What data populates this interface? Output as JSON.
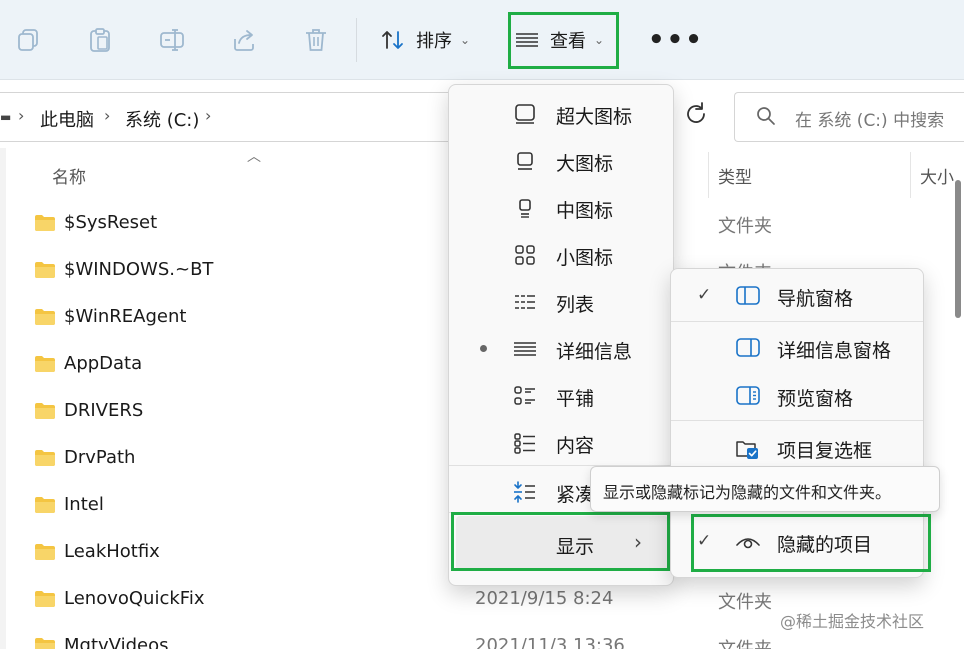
{
  "toolbar": {
    "sort_label": "排序",
    "view_label": "查看",
    "more_label": "•••"
  },
  "address": {
    "crumbs": [
      "此电脑",
      "系统 (C:)"
    ],
    "search_placeholder": "在 系统 (C:) 中搜索"
  },
  "columns": {
    "name": "名称",
    "type": "类型",
    "size_partial": "大小"
  },
  "rows": [
    {
      "name": "$SysReset",
      "date": "",
      "type": "文件夹"
    },
    {
      "name": "$WINDOWS.~BT",
      "date": "",
      "type": "文件夹"
    },
    {
      "name": "$WinREAgent",
      "date": "",
      "type": ""
    },
    {
      "name": "AppData",
      "date": "",
      "type": ""
    },
    {
      "name": "DRIVERS",
      "date": "",
      "type": ""
    },
    {
      "name": "DrvPath",
      "date": "",
      "type": ""
    },
    {
      "name": "Intel",
      "date": "",
      "type": ""
    },
    {
      "name": "LeakHotfix",
      "date": "",
      "type": ""
    },
    {
      "name": "LenovoQuickFix",
      "date": "2021/9/15 8:24",
      "type": "文件夹"
    },
    {
      "name": "MgtvVideos",
      "date": "2021/11/3 13:36",
      "type": "文件夹"
    }
  ],
  "view_menu": {
    "items": [
      {
        "label": "超大图标",
        "icon": "extra-large-icons-icon",
        "selected": false
      },
      {
        "label": "大图标",
        "icon": "large-icons-icon",
        "selected": false
      },
      {
        "label": "中图标",
        "icon": "medium-icons-icon",
        "selected": false
      },
      {
        "label": "小图标",
        "icon": "small-icons-icon",
        "selected": false
      },
      {
        "label": "列表",
        "icon": "list-icon",
        "selected": false
      },
      {
        "label": "详细信息",
        "icon": "details-icon",
        "selected": true
      },
      {
        "label": "平铺",
        "icon": "tiles-icon",
        "selected": false
      },
      {
        "label": "内容",
        "icon": "content-icon",
        "selected": false
      },
      {
        "label": "紧凑",
        "icon": "compact-icon",
        "selected": false
      }
    ],
    "show_label": "显示"
  },
  "show_submenu": {
    "items": [
      {
        "label": "导航窗格",
        "icon": "navigation-pane-icon",
        "checked": true
      },
      {
        "label": "详细信息窗格",
        "icon": "details-pane-icon",
        "checked": false
      },
      {
        "label": "预览窗格",
        "icon": "preview-pane-icon",
        "checked": false
      },
      {
        "label": "项目复选框",
        "icon": "item-checkbox-icon",
        "checked": false
      },
      {
        "label": "隐藏的项目",
        "icon": "eye-icon",
        "checked": true
      }
    ]
  },
  "tooltip": "显示或隐藏标记为隐藏的文件和文件夹。",
  "watermark": "@稀土掘金技术社区",
  "colors": {
    "highlight": "#1fad45",
    "toolbar_bg": "#edf3f8",
    "folder": "#f4c542",
    "accent": "#1a73c8"
  }
}
